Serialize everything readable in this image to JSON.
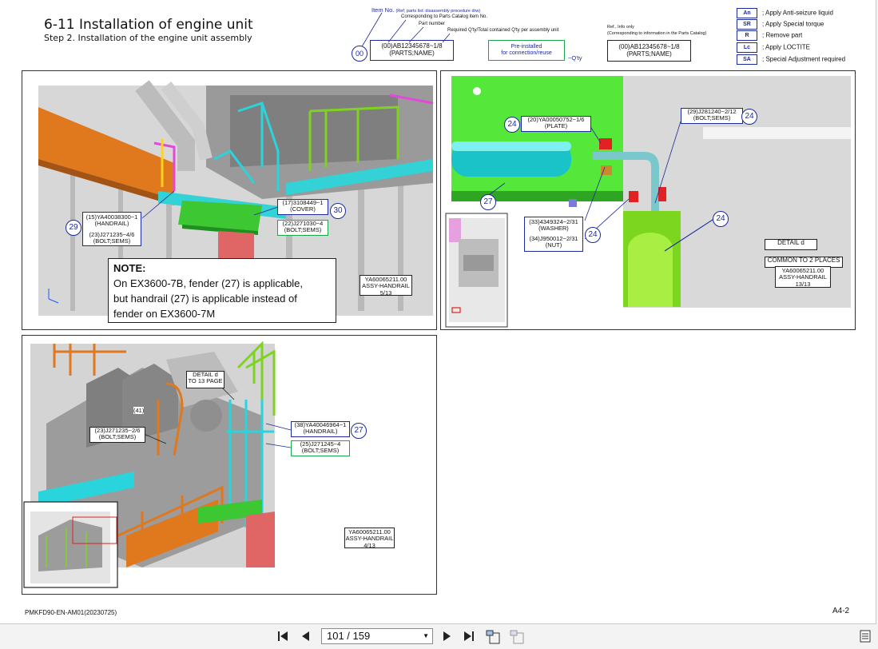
{
  "header": {
    "title": "6-11 Installation of engine unit",
    "subtitle": "Step 2. Installation of the engine unit assembly"
  },
  "key": {
    "item_no": "Item No.",
    "item_no_ref": "(Ref; parts list: disassembly procedure drw)",
    "corresponding": "Corresponding to Parts Catalog item No.",
    "part_number": "Part number",
    "required_qty": "Required Q'ty/Total contained Q'ty per assembly unit",
    "circle": "00",
    "box_line1": "(00)AB12345678~1/8",
    "box_line2": "(PARTS;NAME)",
    "green_line1": "Pre-installed",
    "green_line2": "for connection/reuse",
    "qty_suffix": "~Q'ty",
    "ref_title": "Ref., Info only",
    "ref_sub": "(Corresponding to information in the Parts Catalog)",
    "ref_line1": "(00)AB12345678~1/8",
    "ref_line2": "(PARTS;NAME)"
  },
  "legend": [
    {
      "code": "An",
      "text": "; Apply Anti-seizure liquid"
    },
    {
      "code": "SR",
      "text": "; Apply Special torque"
    },
    {
      "code": "R",
      "text": "; Remove part"
    },
    {
      "code": "Lc",
      "text": "; Apply LOCTITE"
    },
    {
      "code": "SA",
      "text": "; Special Adjustment required"
    }
  ],
  "panel1": {
    "c29": "29",
    "c30": "30",
    "handrail_l1": "(15)YA40038300~1",
    "handrail_l2": "(HANDRAIL)",
    "bolt_l1": "(23)J271235~4/6",
    "bolt_l2": "(BOLT;SEMS)",
    "cover_l1": "(17)3108449~1",
    "cover_l2": "(COVER)",
    "bolt2_l1": "(22)J271030~4",
    "bolt2_l2": "(BOLT;SEMS)",
    "assy_l1": "YA60065211.00",
    "assy_l2": "ASSY-HANDRAIL",
    "assy_l3": "5/13",
    "note_title": "NOTE:",
    "note_l1": "On EX3600-7B, fender (27) is applicable,",
    "note_l2": "but handrail (27) is applicable instead of",
    "note_l3": "fender on EX3600-7M"
  },
  "panel2": {
    "c24a": "24",
    "c24b": "24",
    "c24c": "24",
    "c24d": "24",
    "c27": "27",
    "plate_l1": "(20)YA00050752~1/6",
    "plate_l2": "(PLATE)",
    "bolt_l1": "(29)J281240~2/12",
    "bolt_l2": "(BOLT;SEMS)",
    "washer_l1": "(33)4349324~2/31",
    "washer_l2": "(WASHER)",
    "nut_l1": "(34)J950012~2/31",
    "nut_l2": "(NUT)",
    "detail": "DETAIL d",
    "common": "COMMON TO 2 PLACES",
    "assy_l1": "YA60065211.00",
    "assy_l2": "ASSY-HANDRAIL",
    "assy_l3": "13/13"
  },
  "panel3": {
    "c27": "27",
    "detail_l1": "DETAIL d",
    "detail_l2": "TO 13 PAGE",
    "item41": "(41)",
    "bolt_l1": "(23)J271235~2/6",
    "bolt_l2": "(BOLT;SEMS)",
    "handrail_l1": "(38)YA40046964~1",
    "handrail_l2": "(HANDRAIL)",
    "bolt2_l1": "(25)J271245~4",
    "bolt2_l2": "(BOLT;SEMS)",
    "assy_l1": "YA60065211.00",
    "assy_l2": "ASSY-HANDRAIL",
    "assy_l3": "4/13"
  },
  "footer": {
    "doc_code": "PMKFD90-EN-AM01(20230725)",
    "page_code": "A4-2"
  },
  "toolbar": {
    "page_display": "101 / 159"
  },
  "colors": {
    "accent_blue": "#1c2a9c",
    "accent_green": "#1aa64a",
    "machine_green": "#55e83a",
    "machine_cyan": "#32d2d6",
    "machine_orange": "#e0781e"
  }
}
